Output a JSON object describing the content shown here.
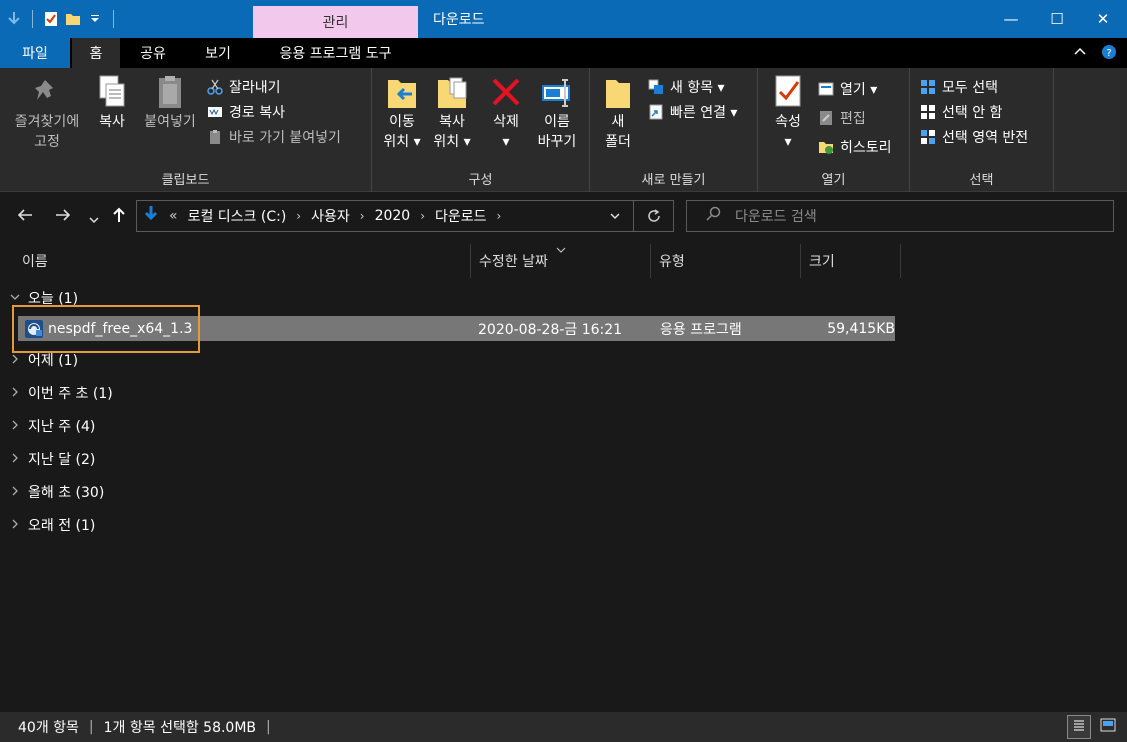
{
  "window": {
    "context_tab": "관리",
    "title": "다운로드",
    "minimize": "—",
    "maximize": "☐",
    "close": "✕"
  },
  "tabs": {
    "file": "파일",
    "home": "홈",
    "share": "공유",
    "view": "보기",
    "app_tools": "응용 프로그램 도구"
  },
  "ribbon": {
    "clipboard": {
      "label": "클립보드",
      "pin": [
        "즐겨찾기에",
        "고정"
      ],
      "copy": "복사",
      "paste": "붙여넣기",
      "cut": "잘라내기",
      "copy_path": "경로 복사",
      "paste_shortcut": "바로 가기 붙여넣기"
    },
    "organize": {
      "label": "구성",
      "move_to": [
        "이동",
        "위치"
      ],
      "copy_to": [
        "복사",
        "위치"
      ],
      "delete": "삭제",
      "rename": [
        "이름",
        "바꾸기"
      ]
    },
    "new": {
      "label": "새로 만들기",
      "new_folder": [
        "새",
        "폴더"
      ],
      "new_item": "새 항목",
      "easy_access": "빠른 연결"
    },
    "open": {
      "label": "열기",
      "properties": "속성",
      "open": "열기",
      "edit": "편집",
      "history": "히스토리"
    },
    "select": {
      "label": "선택",
      "select_all": "모두 선택",
      "select_none": "선택 안 함",
      "invert": "선택 영역 반전"
    }
  },
  "address": {
    "prefix": "«",
    "crumbs": [
      "로컬 디스크 (C:)",
      "사용자",
      "2020",
      "다운로드"
    ],
    "search_placeholder": "다운로드 검색"
  },
  "columns": {
    "name": "이름",
    "modified": "수정한 날짜",
    "type": "유형",
    "size": "크기"
  },
  "groups": {
    "today": "오늘 (1)",
    "yesterday": "어제 (1)",
    "week_start": "이번 주 초 (1)",
    "last_week": "지난 주 (4)",
    "last_month": "지난 달 (2)",
    "year_start": "올해 초 (30)",
    "long_ago": "오래 전 (1)"
  },
  "file": {
    "name": "nespdf_free_x64_1.3",
    "modified": "2020-08-28-금 16:21",
    "type": "응용 프로그램",
    "size": "59,415KB"
  },
  "status": {
    "count": "40개 항목",
    "selected": "1개 항목 선택함 58.0MB"
  },
  "colors": {
    "accent": "#0b6ab6",
    "context_tab": "#f2c9ed",
    "selection": "#777777",
    "highlight_border": "#e59a39"
  }
}
